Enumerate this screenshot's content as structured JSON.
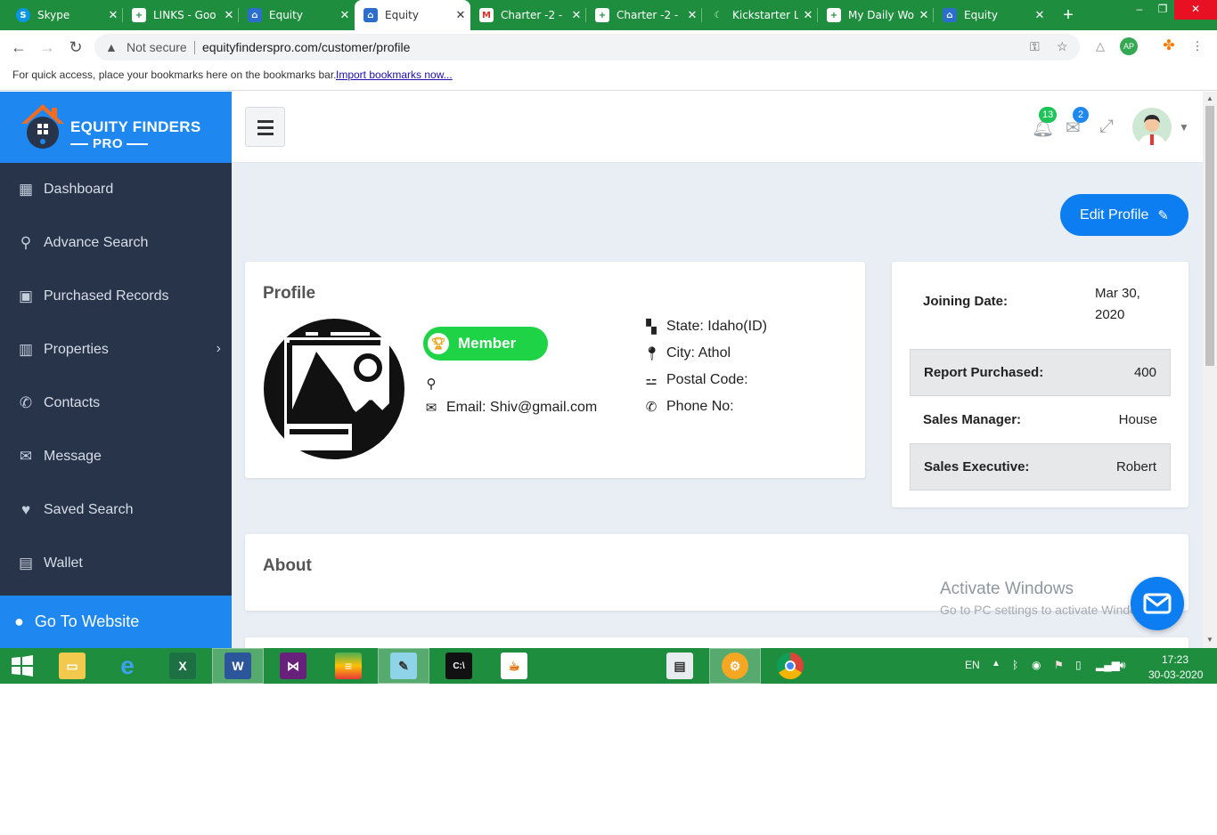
{
  "browser": {
    "tabs": [
      {
        "title": "Skype",
        "icon": "skype-icon"
      },
      {
        "title": "LINKS - Goo",
        "icon": "sheets-icon"
      },
      {
        "title": "Equity",
        "icon": "equity-icon"
      },
      {
        "title": "Equity",
        "icon": "equity-icon",
        "active": true
      },
      {
        "title": "Charter -2 -",
        "icon": "gmail-icon"
      },
      {
        "title": "Charter -2 -",
        "icon": "sheets-icon"
      },
      {
        "title": "Kickstarter L",
        "icon": "kickstarter-icon"
      },
      {
        "title": "My Daily Wo",
        "icon": "sheets-icon"
      },
      {
        "title": "Equity",
        "icon": "equity-icon"
      }
    ],
    "security_label": "Not secure",
    "url": "equityfinderspro.com/customer/profile",
    "bookmarks_hint": "For quick access, place your bookmarks here on the bookmarks bar.",
    "import_link": "Import bookmarks now..."
  },
  "app": {
    "logo_line1": "EQUITY FINDERS",
    "logo_line2": "PRO",
    "brand_color": "#1e88f0",
    "sidebar_color": "#27344a",
    "menu": [
      {
        "label": "Dashboard",
        "icon": "dashboard-icon"
      },
      {
        "label": "Advance Search",
        "icon": "search-icon"
      },
      {
        "label": "Purchased Records",
        "icon": "shopping-bag-icon"
      },
      {
        "label": "Properties",
        "icon": "building-icon",
        "has_submenu": true
      },
      {
        "label": "Contacts",
        "icon": "phone-icon"
      },
      {
        "label": "Message",
        "icon": "envelope-icon"
      },
      {
        "label": "Saved Search",
        "icon": "heart-icon"
      },
      {
        "label": "Wallet",
        "icon": "briefcase-icon"
      }
    ],
    "goto_website": "Go To Website",
    "notifications_count": "13",
    "messages_count": "2",
    "edit_profile": "Edit Profile"
  },
  "profile": {
    "title": "Profile",
    "membership": "Member",
    "location": "",
    "email": "Email: Shiv@gmail.com",
    "state": "State: Idaho(ID)",
    "city": "City: Athol",
    "postal_code": "Postal Code:",
    "phone": "Phone No:"
  },
  "account": {
    "joining_label": "Joining Date:",
    "joining_value": "Mar 30, 2020",
    "report_label": "Report Purchased:",
    "report_value": "400",
    "manager_label": "Sales Manager:",
    "manager_value": "House",
    "executive_label": "Sales Executive:",
    "executive_value": "Robert"
  },
  "about": {
    "title": "About"
  },
  "watermark": {
    "line1": "Activate Windows",
    "line2": "Go to PC settings to activate Windows."
  },
  "taskbar": {
    "language": "EN",
    "time": "17:23",
    "date": "30-03-2020"
  }
}
